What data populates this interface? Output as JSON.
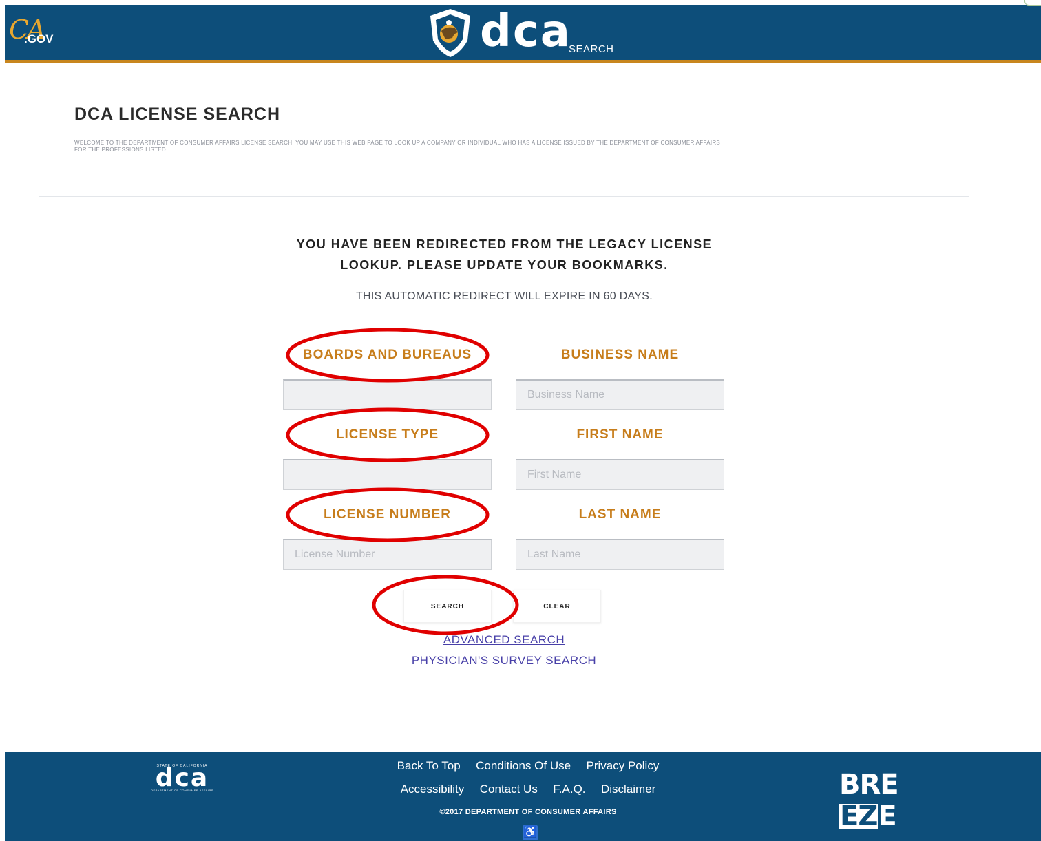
{
  "header": {
    "cagov_logo": {
      "ca": "CA",
      "gov": ".GOV"
    },
    "dca_logo": {
      "letters": "dca",
      "sub": "SEARCH",
      "icon": "bear-shield-icon"
    }
  },
  "intro": {
    "title": "DCA LICENSE SEARCH",
    "welcome": "WELCOME TO THE DEPARTMENT OF CONSUMER AFFAIRS LICENSE SEARCH. YOU MAY USE THIS WEB PAGE TO LOOK UP A COMPANY OR INDIVIDUAL WHO HAS A LICENSE ISSUED BY THE DEPARTMENT OF CONSUMER AFFAIRS FOR THE PROFESSIONS LISTED."
  },
  "redirect": {
    "line1": "YOU HAVE BEEN REDIRECTED FROM THE LEGACY LICENSE",
    "line2": "LOOKUP. PLEASE UPDATE YOUR BOOKMARKS.",
    "expire": "THIS AUTOMATIC REDIRECT WILL EXPIRE IN 60 DAYS."
  },
  "form": {
    "boards_label": "BOARDS AND BUREAUS",
    "boards_value": "",
    "business_label": "BUSINESS NAME",
    "business_placeholder": "Business Name",
    "license_type_label": "LICENSE TYPE",
    "license_type_value": "",
    "first_name_label": "FIRST NAME",
    "first_name_placeholder": "First Name",
    "license_number_label": "LICENSE NUMBER",
    "license_number_placeholder": "License Number",
    "last_name_label": "LAST NAME",
    "last_name_placeholder": "Last Name",
    "search_label": "SEARCH",
    "clear_label": "CLEAR"
  },
  "links": {
    "advanced": "ADVANCED SEARCH",
    "physician": "PHYSICIAN'S SURVEY SEARCH"
  },
  "footer": {
    "dca_logo": {
      "state": "STATE OF CALIFORNIA",
      "letters": "dca",
      "dept": "DEPARTMENT OF CONSUMER AFFAIRS"
    },
    "links_row1": [
      "Back To Top",
      "Conditions Of Use",
      "Privacy Policy"
    ],
    "links_row2": [
      "Accessibility",
      "Contact Us",
      "F.A.Q.",
      "Disclaimer"
    ],
    "copyright": "©2017 DEPARTMENT OF CONSUMER AFFAIRS",
    "breeze": {
      "pre": "BRE",
      "mid": "EZ",
      "post": "E"
    },
    "accessibility_icon": "wheelchair-icon"
  },
  "colors": {
    "header_blue": "#0d4e7a",
    "accent_orange": "#c77d1b",
    "annotation_red": "#e00000",
    "link_purple": "#4840a8"
  }
}
